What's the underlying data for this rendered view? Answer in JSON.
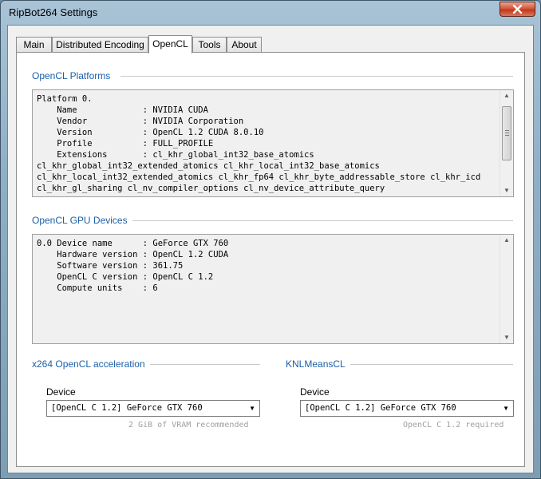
{
  "window": {
    "title": "RipBot264 Settings"
  },
  "tabs": [
    {
      "label": "Main"
    },
    {
      "label": "Distributed Encoding"
    },
    {
      "label": "OpenCL"
    },
    {
      "label": "Tools"
    },
    {
      "label": "About"
    }
  ],
  "platforms": {
    "title": "OpenCL Platforms",
    "text": "Platform 0.\n    Name             : NVIDIA CUDA\n    Vendor           : NVIDIA Corporation\n    Version          : OpenCL 1.2 CUDA 8.0.10\n    Profile          : FULL_PROFILE\n    Extensions       : cl_khr_global_int32_base_atomics\ncl_khr_global_int32_extended_atomics cl_khr_local_int32_base_atomics\ncl_khr_local_int32_extended_atomics cl_khr_fp64 cl_khr_byte_addressable_store cl_khr_icd\ncl_khr_gl_sharing cl_nv_compiler_options cl_nv_device_attribute_query"
  },
  "gpu_devices": {
    "title": "OpenCL GPU Devices",
    "text": "0.0 Device name      : GeForce GTX 760\n    Hardware version : OpenCL 1.2 CUDA\n    Software version : 361.75\n    OpenCL C version : OpenCL C 1.2\n    Compute units    : 6"
  },
  "x264": {
    "title": "x264 OpenCL acceleration",
    "device_label": "Device",
    "device_value": "[OpenCL C 1.2] GeForce GTX 760",
    "hint": "2 GiB of VRAM recommended"
  },
  "knlmeans": {
    "title": "KNLMeansCL",
    "device_label": "Device",
    "device_value": "[OpenCL C 1.2] GeForce GTX 760",
    "hint": "OpenCL C 1.2 required"
  },
  "colors": {
    "accent": "#1c5fa8",
    "close": "#c0391c"
  }
}
